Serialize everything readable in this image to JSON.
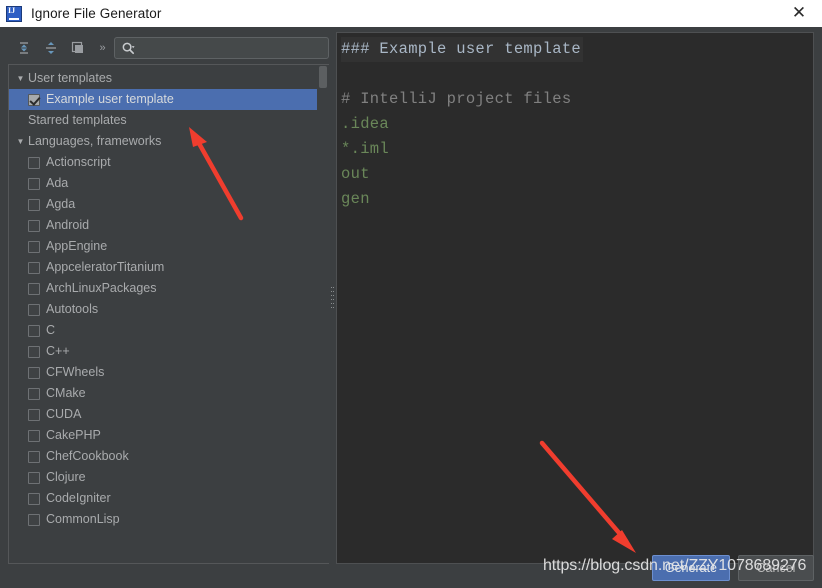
{
  "window": {
    "title": "Ignore File Generator",
    "app_icon": "intellij-idea-icon",
    "close_icon": "close-icon"
  },
  "toolbar": {
    "expand_all_icon": "expand-all-icon",
    "collapse_all_icon": "collapse-all-icon",
    "copy_icon": "copy-icon",
    "more_icon": "chevron-double-right-icon",
    "search_icon": "search-icon",
    "search_value": "",
    "search_placeholder": ""
  },
  "tree": {
    "groups": [
      {
        "label": "User templates",
        "expanded": true,
        "triangle": "▼",
        "items": [
          {
            "label": "Example user template",
            "checked": true,
            "selected": true
          }
        ]
      },
      {
        "label": "Starred templates",
        "expanded": false,
        "triangle": "",
        "items": []
      },
      {
        "label": "Languages, frameworks",
        "expanded": true,
        "triangle": "▼",
        "items": [
          {
            "label": "Actionscript",
            "checked": false,
            "selected": false
          },
          {
            "label": "Ada",
            "checked": false,
            "selected": false
          },
          {
            "label": "Agda",
            "checked": false,
            "selected": false
          },
          {
            "label": "Android",
            "checked": false,
            "selected": false
          },
          {
            "label": "AppEngine",
            "checked": false,
            "selected": false
          },
          {
            "label": "AppceleratorTitanium",
            "checked": false,
            "selected": false
          },
          {
            "label": "ArchLinuxPackages",
            "checked": false,
            "selected": false
          },
          {
            "label": "Autotools",
            "checked": false,
            "selected": false
          },
          {
            "label": "C",
            "checked": false,
            "selected": false
          },
          {
            "label": "C++",
            "checked": false,
            "selected": false
          },
          {
            "label": "CFWheels",
            "checked": false,
            "selected": false
          },
          {
            "label": "CMake",
            "checked": false,
            "selected": false
          },
          {
            "label": "CUDA",
            "checked": false,
            "selected": false
          },
          {
            "label": "CakePHP",
            "checked": false,
            "selected": false
          },
          {
            "label": "ChefCookbook",
            "checked": false,
            "selected": false
          },
          {
            "label": "Clojure",
            "checked": false,
            "selected": false
          },
          {
            "label": "CodeIgniter",
            "checked": false,
            "selected": false
          },
          {
            "label": "CommonLisp",
            "checked": false,
            "selected": false
          }
        ]
      }
    ]
  },
  "preview": {
    "lines": [
      {
        "text": "### Example user template",
        "style": "header"
      },
      {
        "text": "",
        "style": "blank"
      },
      {
        "text": "# IntelliJ project files",
        "style": "comment"
      },
      {
        "text": ".idea",
        "style": "entry"
      },
      {
        "text": "*.iml",
        "style": "entry"
      },
      {
        "text": "out",
        "style": "entry"
      },
      {
        "text": "gen",
        "style": "entry"
      }
    ]
  },
  "buttons": {
    "generate": "Generate",
    "cancel": "Cancel"
  },
  "annotations": {
    "watermark": "https://blog.csdn.net/ZZY1078689276",
    "arrow_color": "#f03d2e",
    "arrow_1": "arrow-pointing-to-selected-template",
    "arrow_2": "arrow-pointing-to-generate-button"
  },
  "colors": {
    "window_bg": "#3c3f41",
    "panel_bg": "#2b2b2b",
    "selection": "#4b6eaf",
    "text": "#a9abad",
    "code_green": "#6a8759",
    "code_comment": "#808080"
  }
}
